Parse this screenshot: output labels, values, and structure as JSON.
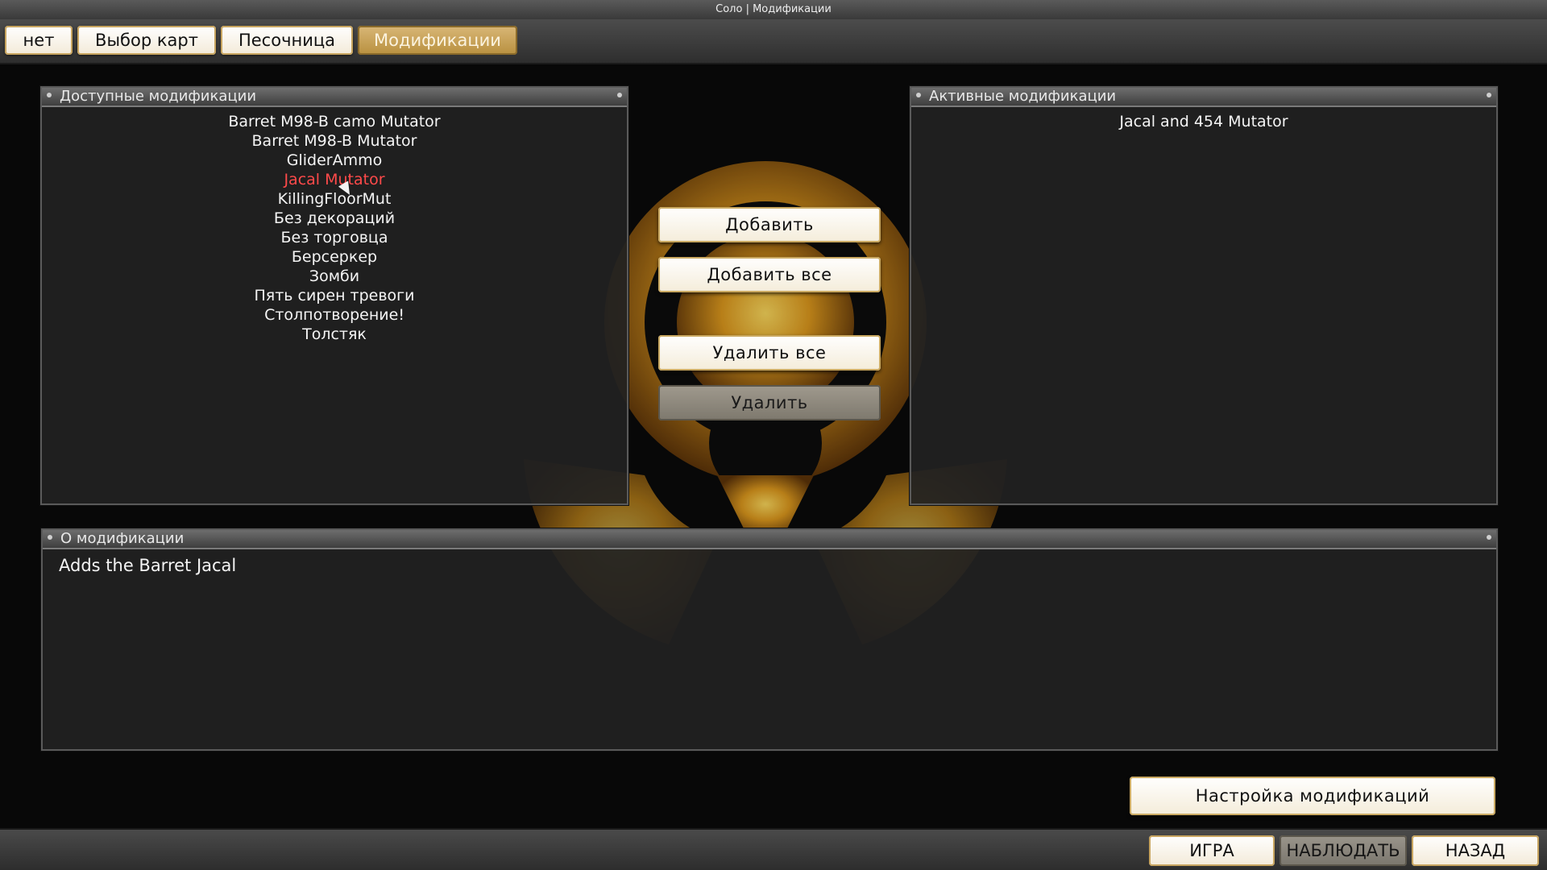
{
  "window": {
    "title": "Соло | Модификации"
  },
  "tabs": [
    {
      "label": "нет"
    },
    {
      "label": "Выбор карт"
    },
    {
      "label": "Песочница"
    },
    {
      "label": "Модификации"
    }
  ],
  "available": {
    "header": "Доступные модификации",
    "items": [
      "Barret M98-B camo Mutator",
      "Barret M98-B Mutator",
      "GliderAmmo",
      "Jacal Mutator",
      "KillingFloorMut",
      "Без декораций",
      "Без торговца",
      "Берсеркер",
      "Зомби",
      "Пять сирен тревоги",
      "Столпотворение!",
      "Толстяк"
    ],
    "selected": "Jacal Mutator"
  },
  "active": {
    "header": "Активные модификации",
    "items": [
      "Jacal and 454 Mutator"
    ]
  },
  "actions": {
    "add": "Добавить",
    "add_all": "Добавить все",
    "remove_all": "Удалить все",
    "remove": "Удалить"
  },
  "info": {
    "header": "О модификации",
    "text": "Adds the Barret Jacal"
  },
  "configure": "Настройка модификаций",
  "bottom": {
    "play": "ИГРА",
    "spectate": "НАБЛЮДАТЬ",
    "back": "НАЗАД"
  },
  "colors": {
    "selected_item": "#ff4a4a",
    "button_border": "#c8a560",
    "active_tab": "#c8a04f"
  }
}
